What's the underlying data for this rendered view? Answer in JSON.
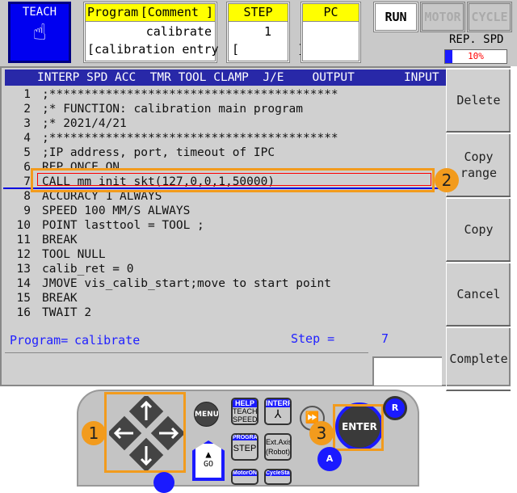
{
  "teach": {
    "label": "TEACH",
    "icon": "hand-pointer-icon"
  },
  "program_box": {
    "header_left": "Program",
    "header_right": "[Comment ]",
    "name": "calibrate",
    "comment": "[calibration entry ]"
  },
  "step_box": {
    "header": "STEP",
    "value": "1",
    "bracket": "[        ]"
  },
  "pc_box": {
    "header": "PC"
  },
  "mode_buttons": [
    "RUN",
    "MOTOR",
    "CYCLE"
  ],
  "rep_spd": {
    "label": "REP. SPD",
    "value": "10%",
    "percent": 10
  },
  "header_columns": "INTERP SPD ACC  TMR TOOL CLAMP  J/E    OUTPUT       INPUT",
  "lines": [
    {
      "n": "1",
      "text": ";*****************************************"
    },
    {
      "n": "2",
      "text": ";* FUNCTION: calibration main program"
    },
    {
      "n": "3",
      "text": ";* 2021/4/21"
    },
    {
      "n": "4",
      "text": ";*****************************************"
    },
    {
      "n": "5",
      "text": ";IP address, port, timeout of IPC"
    },
    {
      "n": "6",
      "text": "REP_ONCE ON"
    },
    {
      "n": "7",
      "text": "CALL mm_init_skt(127,0,0,1,50000)"
    },
    {
      "n": "8",
      "text": "ACCURACY 1 ALWAYS"
    },
    {
      "n": "9",
      "text": "SPEED 100 MM/S ALWAYS"
    },
    {
      "n": "10",
      "text": "POINT lasttool = TOOL ;"
    },
    {
      "n": "11",
      "text": "BREAK"
    },
    {
      "n": "12",
      "text": "TOOL NULL"
    },
    {
      "n": "13",
      "text": "calib_ret = 0"
    },
    {
      "n": "14",
      "text": "JMOVE vis_calib_start;move to start point"
    },
    {
      "n": "15",
      "text": "BREAK"
    },
    {
      "n": "16",
      "text": "TWAIT 2"
    }
  ],
  "side_buttons": [
    "Delete",
    "Copy\nrange",
    "Copy",
    "Cancel",
    "Complete"
  ],
  "status": {
    "program_label": "Program=",
    "program_value": "calibrate",
    "step_label": "Step =",
    "step_value": "7"
  },
  "callouts": [
    "1",
    "2",
    "3"
  ],
  "pendant": {
    "menu": "MENU",
    "help": "HELP",
    "teach_speed": "TEACH SPEED",
    "interp": "INTERP",
    "program": "PROGRAM",
    "step": "STEP",
    "ext_axis": "Ext.Axis (Robot)",
    "go": "GO",
    "motor_on": "MotorON",
    "cycle_start": "CycleStart",
    "enter": "ENTER",
    "r": "R",
    "a": "A"
  },
  "colors": {
    "accent_blue": "#0000f0",
    "header_blue": "#2828a8",
    "callout_orange": "#f29b1d",
    "highlight_red": "#ff0000"
  }
}
